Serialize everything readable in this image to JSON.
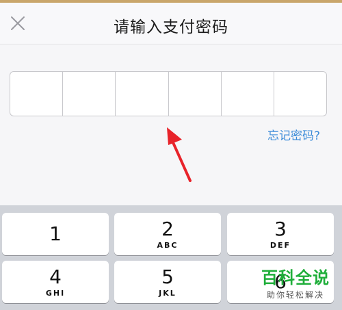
{
  "header": {
    "title": "请输入支付密码",
    "close_icon": "close-icon"
  },
  "pin": {
    "length": 6,
    "entered": 0
  },
  "forgot_link": "忘记密码?",
  "keypad": {
    "keys": [
      {
        "digit": "1",
        "letters": ""
      },
      {
        "digit": "2",
        "letters": "ABC"
      },
      {
        "digit": "3",
        "letters": "DEF"
      },
      {
        "digit": "4",
        "letters": "GHI"
      },
      {
        "digit": "5",
        "letters": "JKL"
      },
      {
        "digit": "6",
        "letters": ""
      }
    ]
  },
  "annotation": {
    "arrow_color": "#e8232a"
  },
  "watermark": {
    "main": "百科全说",
    "sub": "助你轻松解决"
  },
  "colors": {
    "link": "#3b8bd8",
    "watermark": "#1fae3a",
    "keypad_bg": "#d0d3d9"
  }
}
